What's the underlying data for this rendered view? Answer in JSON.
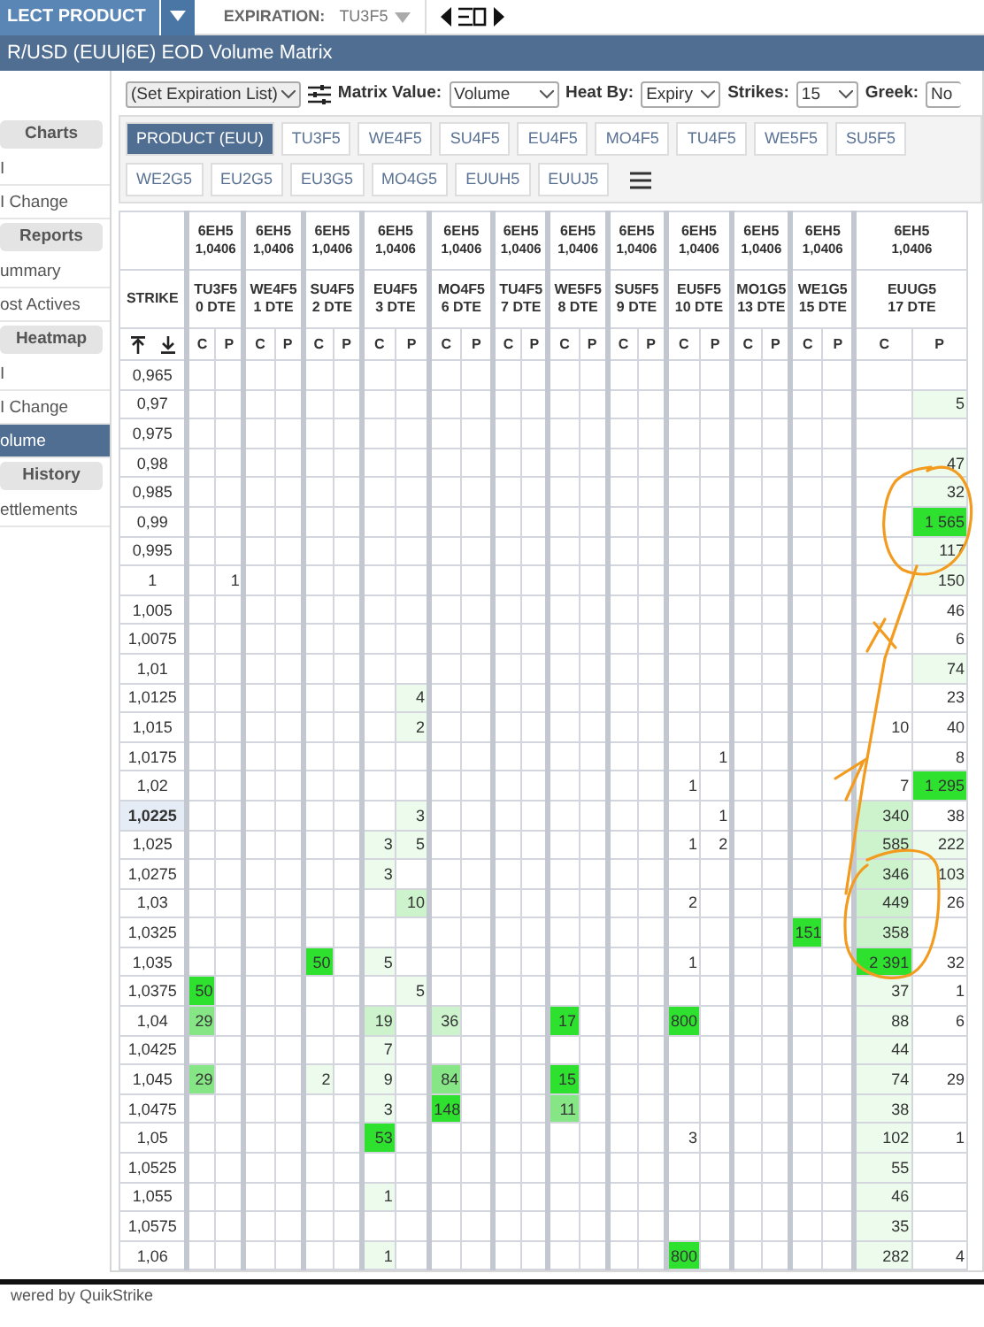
{
  "top_bar": {
    "product_button": "LECT PRODUCT",
    "expiration_label": "EXPIRATION:",
    "expiration_value": "TU3F5"
  },
  "title": "R/USD (EUU|6E) EOD Volume Matrix",
  "sidebar": [
    {
      "kind": "header",
      "label": "Charts"
    },
    {
      "kind": "item",
      "label": "I",
      "selected": false
    },
    {
      "kind": "item",
      "label": "I Change",
      "selected": false
    },
    {
      "kind": "header",
      "label": "Reports"
    },
    {
      "kind": "item",
      "label": "ummary",
      "selected": false
    },
    {
      "kind": "item",
      "label": "ost Actives",
      "selected": false
    },
    {
      "kind": "header",
      "label": "Heatmap"
    },
    {
      "kind": "item",
      "label": "I",
      "selected": false
    },
    {
      "kind": "item",
      "label": "I Change",
      "selected": false
    },
    {
      "kind": "item",
      "label": "olume",
      "selected": true
    },
    {
      "kind": "header",
      "label": "History"
    },
    {
      "kind": "item",
      "label": "ettlements",
      "selected": false
    }
  ],
  "toolbar": {
    "expiration_list": "(Set Expiration List)",
    "fields": [
      {
        "label": "Matrix Value:",
        "value": "Volume"
      },
      {
        "label": "Heat By:",
        "value": "Expiry"
      },
      {
        "label": "Strikes:",
        "value": "15"
      },
      {
        "label": "Greek:",
        "value": "No"
      }
    ]
  },
  "tab_rows": [
    [
      {
        "label": "PRODUCT (EUU)",
        "selected": true
      },
      {
        "label": "TU3F5",
        "selected": false
      },
      {
        "label": "WE4F5",
        "selected": false
      },
      {
        "label": "SU4F5",
        "selected": false
      },
      {
        "label": "EU4F5",
        "selected": false
      },
      {
        "label": "MO4F5",
        "selected": false
      },
      {
        "label": "TU4F5",
        "selected": false
      },
      {
        "label": "WE5F5",
        "selected": false
      },
      {
        "label": "SU5F5",
        "selected": false
      }
    ],
    [
      {
        "label": "WE2G5",
        "selected": false
      },
      {
        "label": "EU2G5",
        "selected": false
      },
      {
        "label": "EU3G5",
        "selected": false
      },
      {
        "label": "MO4G5",
        "selected": false
      },
      {
        "label": "EUUH5",
        "selected": false
      },
      {
        "label": "EUUJ5",
        "selected": false
      }
    ]
  ],
  "matrix": {
    "strike_label": "STRIKE",
    "expiries": [
      {
        "future": "6EH5",
        "price": "1,0406",
        "name": "TU3F5",
        "dte": "0 DTE",
        "call": "C",
        "put": "P"
      },
      {
        "future": "6EH5",
        "price": "1,0406",
        "name": "WE4F5",
        "dte": "1 DTE",
        "call": "C",
        "put": "P"
      },
      {
        "future": "6EH5",
        "price": "1,0406",
        "name": "SU4F5",
        "dte": "2 DTE",
        "call": "C",
        "put": "P"
      },
      {
        "future": "6EH5",
        "price": "1,0406",
        "name": "EU4F5",
        "dte": "3 DTE",
        "call": "C",
        "put": "P"
      },
      {
        "future": "6EH5",
        "price": "1,0406",
        "name": "MO4F5",
        "dte": "6 DTE",
        "call": "C",
        "put": "P"
      },
      {
        "future": "6EH5",
        "price": "1,0406",
        "name": "TU4F5",
        "dte": "7 DTE",
        "call": "C",
        "put": "P"
      },
      {
        "future": "6EH5",
        "price": "1,0406",
        "name": "WE5F5",
        "dte": "8 DTE",
        "call": "C",
        "put": "P"
      },
      {
        "future": "6EH5",
        "price": "1,0406",
        "name": "SU5F5",
        "dte": "9 DTE",
        "call": "C",
        "put": "P"
      },
      {
        "future": "6EH5",
        "price": "1,0406",
        "name": "EU5F5",
        "dte": "10 DTE",
        "call": "C",
        "put": "P"
      },
      {
        "future": "6EH5",
        "price": "1,0406",
        "name": "MO1G5",
        "dte": "13 DTE",
        "call": "C",
        "put": "P"
      },
      {
        "future": "6EH5",
        "price": "1,0406",
        "name": "WE1G5",
        "dte": "15 DTE",
        "call": "C",
        "put": "P"
      },
      {
        "future": "6EH5",
        "price": "1,0406",
        "name": "EUUG5",
        "dte": "17 DTE",
        "call": "C",
        "put": "P"
      }
    ],
    "rows": [
      {
        "strike": "0,965",
        "atm": false,
        "cells": [
          [
            null,
            null
          ],
          [
            null,
            null
          ],
          [
            null,
            null
          ],
          [
            null,
            null
          ],
          [
            null,
            null
          ],
          [
            null,
            null
          ],
          [
            null,
            null
          ],
          [
            null,
            null
          ],
          [
            null,
            null
          ],
          [
            null,
            null
          ],
          [
            null,
            null
          ],
          [
            null,
            null
          ]
        ]
      },
      {
        "strike": "0,97",
        "atm": false,
        "cells": [
          [
            null,
            null
          ],
          [
            null,
            null
          ],
          [
            null,
            null
          ],
          [
            null,
            null
          ],
          [
            null,
            null
          ],
          [
            null,
            null
          ],
          [
            null,
            null
          ],
          [
            null,
            null
          ],
          [
            null,
            null
          ],
          [
            null,
            null
          ],
          [
            null,
            null
          ],
          [
            null,
            {
              "value": "5",
              "color": "#ecfbec"
            }
          ]
        ]
      },
      {
        "strike": "0,975",
        "atm": false,
        "cells": [
          [
            null,
            null
          ],
          [
            null,
            null
          ],
          [
            null,
            null
          ],
          [
            null,
            null
          ],
          [
            null,
            null
          ],
          [
            null,
            null
          ],
          [
            null,
            null
          ],
          [
            null,
            null
          ],
          [
            null,
            null
          ],
          [
            null,
            null
          ],
          [
            null,
            null
          ],
          [
            null,
            null
          ]
        ]
      },
      {
        "strike": "0,98",
        "atm": false,
        "cells": [
          [
            null,
            null
          ],
          [
            null,
            null
          ],
          [
            null,
            null
          ],
          [
            null,
            null
          ],
          [
            null,
            null
          ],
          [
            null,
            null
          ],
          [
            null,
            null
          ],
          [
            null,
            null
          ],
          [
            null,
            null
          ],
          [
            null,
            null
          ],
          [
            null,
            null
          ],
          [
            null,
            {
              "value": "47",
              "color": "#ecfbec"
            }
          ]
        ]
      },
      {
        "strike": "0,985",
        "atm": false,
        "cells": [
          [
            null,
            null
          ],
          [
            null,
            null
          ],
          [
            null,
            null
          ],
          [
            null,
            null
          ],
          [
            null,
            null
          ],
          [
            null,
            null
          ],
          [
            null,
            null
          ],
          [
            null,
            null
          ],
          [
            null,
            null
          ],
          [
            null,
            null
          ],
          [
            null,
            null
          ],
          [
            null,
            {
              "value": "32",
              "color": "#ecfbec"
            }
          ]
        ]
      },
      {
        "strike": "0,99",
        "atm": false,
        "cells": [
          [
            null,
            null
          ],
          [
            null,
            null
          ],
          [
            null,
            null
          ],
          [
            null,
            null
          ],
          [
            null,
            null
          ],
          [
            null,
            null
          ],
          [
            null,
            null
          ],
          [
            null,
            null
          ],
          [
            null,
            null
          ],
          [
            null,
            null
          ],
          [
            null,
            null
          ],
          [
            null,
            {
              "value": "1 565",
              "color": "#2fe12f"
            }
          ]
        ]
      },
      {
        "strike": "0,995",
        "atm": false,
        "cells": [
          [
            null,
            null
          ],
          [
            null,
            null
          ],
          [
            null,
            null
          ],
          [
            null,
            null
          ],
          [
            null,
            null
          ],
          [
            null,
            null
          ],
          [
            null,
            null
          ],
          [
            null,
            null
          ],
          [
            null,
            null
          ],
          [
            null,
            null
          ],
          [
            null,
            null
          ],
          [
            null,
            {
              "value": "117",
              "color": "#ecfbec"
            }
          ]
        ]
      },
      {
        "strike": "1",
        "atm": false,
        "cells": [
          [
            null,
            {
              "value": "1"
            }
          ],
          [
            null,
            null
          ],
          [
            null,
            null
          ],
          [
            null,
            null
          ],
          [
            null,
            null
          ],
          [
            null,
            null
          ],
          [
            null,
            null
          ],
          [
            null,
            null
          ],
          [
            null,
            null
          ],
          [
            null,
            null
          ],
          [
            null,
            null
          ],
          [
            null,
            {
              "value": "150",
              "color": "#ecfbec"
            }
          ]
        ]
      },
      {
        "strike": "1,005",
        "atm": false,
        "cells": [
          [
            null,
            null
          ],
          [
            null,
            null
          ],
          [
            null,
            null
          ],
          [
            null,
            null
          ],
          [
            null,
            null
          ],
          [
            null,
            null
          ],
          [
            null,
            null
          ],
          [
            null,
            null
          ],
          [
            null,
            null
          ],
          [
            null,
            null
          ],
          [
            null,
            null
          ],
          [
            null,
            {
              "value": "46"
            }
          ]
        ]
      },
      {
        "strike": "1,0075",
        "atm": false,
        "cells": [
          [
            null,
            null
          ],
          [
            null,
            null
          ],
          [
            null,
            null
          ],
          [
            null,
            null
          ],
          [
            null,
            null
          ],
          [
            null,
            null
          ],
          [
            null,
            null
          ],
          [
            null,
            null
          ],
          [
            null,
            null
          ],
          [
            null,
            null
          ],
          [
            null,
            null
          ],
          [
            null,
            {
              "value": "6"
            }
          ]
        ]
      },
      {
        "strike": "1,01",
        "atm": false,
        "cells": [
          [
            null,
            null
          ],
          [
            null,
            null
          ],
          [
            null,
            null
          ],
          [
            null,
            null
          ],
          [
            null,
            null
          ],
          [
            null,
            null
          ],
          [
            null,
            null
          ],
          [
            null,
            null
          ],
          [
            null,
            null
          ],
          [
            null,
            null
          ],
          [
            null,
            null
          ],
          [
            null,
            {
              "value": "74",
              "color": "#ecfbec"
            }
          ]
        ]
      },
      {
        "strike": "1,0125",
        "atm": false,
        "cells": [
          [
            null,
            null
          ],
          [
            null,
            null
          ],
          [
            null,
            null
          ],
          [
            null,
            {
              "value": "4",
              "color": "#ecfbec"
            }
          ],
          [
            null,
            null
          ],
          [
            null,
            null
          ],
          [
            null,
            null
          ],
          [
            null,
            null
          ],
          [
            null,
            null
          ],
          [
            null,
            null
          ],
          [
            null,
            null
          ],
          [
            null,
            {
              "value": "23"
            }
          ]
        ]
      },
      {
        "strike": "1,015",
        "atm": false,
        "cells": [
          [
            null,
            null
          ],
          [
            null,
            null
          ],
          [
            null,
            null
          ],
          [
            null,
            {
              "value": "2",
              "color": "#ecfbec"
            }
          ],
          [
            null,
            null
          ],
          [
            null,
            null
          ],
          [
            null,
            null
          ],
          [
            null,
            null
          ],
          [
            null,
            null
          ],
          [
            null,
            null
          ],
          [
            null,
            null
          ],
          [
            {
              "value": "10"
            },
            {
              "value": "40"
            }
          ]
        ]
      },
      {
        "strike": "1,0175",
        "atm": false,
        "cells": [
          [
            null,
            null
          ],
          [
            null,
            null
          ],
          [
            null,
            null
          ],
          [
            null,
            null
          ],
          [
            null,
            null
          ],
          [
            null,
            null
          ],
          [
            null,
            null
          ],
          [
            null,
            null
          ],
          [
            null,
            {
              "value": "1"
            }
          ],
          [
            null,
            null
          ],
          [
            null,
            null
          ],
          [
            null,
            {
              "value": "8"
            }
          ]
        ]
      },
      {
        "strike": "1,02",
        "atm": false,
        "cells": [
          [
            null,
            null
          ],
          [
            null,
            null
          ],
          [
            null,
            null
          ],
          [
            null,
            null
          ],
          [
            null,
            null
          ],
          [
            null,
            null
          ],
          [
            null,
            null
          ],
          [
            null,
            null
          ],
          [
            {
              "value": "1"
            },
            null
          ],
          [
            null,
            null
          ],
          [
            null,
            null
          ],
          [
            {
              "value": "7"
            },
            {
              "value": "1 295",
              "color": "#2fe12f"
            }
          ]
        ]
      },
      {
        "strike": "1,0225",
        "atm": true,
        "cells": [
          [
            null,
            null
          ],
          [
            null,
            null
          ],
          [
            null,
            null
          ],
          [
            null,
            {
              "value": "3",
              "color": "#ecfbec"
            }
          ],
          [
            null,
            null
          ],
          [
            null,
            null
          ],
          [
            null,
            null
          ],
          [
            null,
            null
          ],
          [
            null,
            {
              "value": "1"
            }
          ],
          [
            null,
            null
          ],
          [
            null,
            null
          ],
          [
            {
              "value": "340",
              "color": "#cdf3cd"
            },
            {
              "value": "38"
            }
          ]
        ]
      },
      {
        "strike": "1,025",
        "atm": false,
        "cells": [
          [
            null,
            null
          ],
          [
            null,
            null
          ],
          [
            null,
            null
          ],
          [
            {
              "value": "3",
              "color": "#ecfbec"
            },
            {
              "value": "5",
              "color": "#ecfbec"
            }
          ],
          [
            null,
            null
          ],
          [
            null,
            null
          ],
          [
            null,
            null
          ],
          [
            null,
            null
          ],
          [
            {
              "value": "1"
            },
            {
              "value": "2"
            }
          ],
          [
            null,
            null
          ],
          [
            null,
            null
          ],
          [
            {
              "value": "585",
              "color": "#cdf3cd"
            },
            {
              "value": "222",
              "color": "#ecfbec"
            }
          ]
        ]
      },
      {
        "strike": "1,0275",
        "atm": false,
        "cells": [
          [
            null,
            null
          ],
          [
            null,
            null
          ],
          [
            null,
            null
          ],
          [
            {
              "value": "3",
              "color": "#ecfbec"
            },
            null
          ],
          [
            null,
            null
          ],
          [
            null,
            null
          ],
          [
            null,
            null
          ],
          [
            null,
            null
          ],
          [
            null,
            null
          ],
          [
            null,
            null
          ],
          [
            null,
            null
          ],
          [
            {
              "value": "346",
              "color": "#cdf3cd"
            },
            {
              "value": "103",
              "color": "#ecfbec"
            }
          ]
        ]
      },
      {
        "strike": "1,03",
        "atm": false,
        "cells": [
          [
            null,
            null
          ],
          [
            null,
            null
          ],
          [
            null,
            null
          ],
          [
            null,
            {
              "value": "10",
              "color": "#cdf3cd"
            }
          ],
          [
            null,
            null
          ],
          [
            null,
            null
          ],
          [
            null,
            null
          ],
          [
            null,
            null
          ],
          [
            {
              "value": "2"
            },
            null
          ],
          [
            null,
            null
          ],
          [
            null,
            null
          ],
          [
            {
              "value": "449",
              "color": "#cdf3cd"
            },
            {
              "value": "26"
            }
          ]
        ]
      },
      {
        "strike": "1,0325",
        "atm": false,
        "cells": [
          [
            null,
            null
          ],
          [
            null,
            null
          ],
          [
            null,
            null
          ],
          [
            null,
            null
          ],
          [
            null,
            null
          ],
          [
            null,
            null
          ],
          [
            null,
            null
          ],
          [
            null,
            null
          ],
          [
            null,
            null
          ],
          [
            null,
            null
          ],
          [
            {
              "value": "151",
              "color": "#2fe12f"
            },
            null
          ],
          [
            {
              "value": "358",
              "color": "#cdf3cd"
            },
            null
          ]
        ]
      },
      {
        "strike": "1,035",
        "atm": false,
        "cells": [
          [
            null,
            null
          ],
          [
            null,
            null
          ],
          [
            {
              "value": "50",
              "color": "#2fe12f"
            },
            null
          ],
          [
            {
              "value": "5",
              "color": "#ecfbec"
            },
            null
          ],
          [
            null,
            null
          ],
          [
            null,
            null
          ],
          [
            null,
            null
          ],
          [
            null,
            null
          ],
          [
            {
              "value": "1"
            },
            null
          ],
          [
            null,
            null
          ],
          [
            null,
            null
          ],
          [
            {
              "value": "2 391",
              "color": "#2fe12f"
            },
            {
              "value": "32"
            }
          ]
        ]
      },
      {
        "strike": "1,0375",
        "atm": false,
        "cells": [
          [
            {
              "value": "50",
              "color": "#2fe12f"
            },
            null
          ],
          [
            null,
            null
          ],
          [
            null,
            null
          ],
          [
            null,
            {
              "value": "5",
              "color": "#ecfbec"
            }
          ],
          [
            null,
            null
          ],
          [
            null,
            null
          ],
          [
            null,
            null
          ],
          [
            null,
            null
          ],
          [
            null,
            null
          ],
          [
            null,
            null
          ],
          [
            null,
            null
          ],
          [
            {
              "value": "37",
              "color": "#ecfbec"
            },
            {
              "value": "1"
            }
          ]
        ]
      },
      {
        "strike": "1,04",
        "atm": false,
        "cells": [
          [
            {
              "value": "29",
              "color": "#86e686"
            },
            null
          ],
          [
            null,
            null
          ],
          [
            null,
            null
          ],
          [
            {
              "value": "19",
              "color": "#cdf3cd"
            },
            null
          ],
          [
            {
              "value": "36",
              "color": "#cdf3cd"
            },
            null
          ],
          [
            null,
            null
          ],
          [
            {
              "value": "17",
              "color": "#2fe12f"
            },
            null
          ],
          [
            null,
            null
          ],
          [
            {
              "value": "800",
              "color": "#2fe12f"
            },
            null
          ],
          [
            null,
            null
          ],
          [
            null,
            null
          ],
          [
            {
              "value": "88",
              "color": "#ecfbec"
            },
            {
              "value": "6"
            }
          ]
        ]
      },
      {
        "strike": "1,0425",
        "atm": false,
        "cells": [
          [
            null,
            null
          ],
          [
            null,
            null
          ],
          [
            null,
            null
          ],
          [
            {
              "value": "7",
              "color": "#ecfbec"
            },
            null
          ],
          [
            null,
            null
          ],
          [
            null,
            null
          ],
          [
            null,
            null
          ],
          [
            null,
            null
          ],
          [
            null,
            null
          ],
          [
            null,
            null
          ],
          [
            null,
            null
          ],
          [
            {
              "value": "44",
              "color": "#ecfbec"
            },
            null
          ]
        ]
      },
      {
        "strike": "1,045",
        "atm": false,
        "cells": [
          [
            {
              "value": "29",
              "color": "#86e686"
            },
            null
          ],
          [
            null,
            null
          ],
          [
            {
              "value": "2",
              "color": "#ecfbec"
            },
            null
          ],
          [
            {
              "value": "9",
              "color": "#ecfbec"
            },
            null
          ],
          [
            {
              "value": "84",
              "color": "#86e686"
            },
            null
          ],
          [
            null,
            null
          ],
          [
            {
              "value": "15",
              "color": "#2fe12f"
            },
            null
          ],
          [
            null,
            null
          ],
          [
            null,
            null
          ],
          [
            null,
            null
          ],
          [
            null,
            null
          ],
          [
            {
              "value": "74",
              "color": "#ecfbec"
            },
            {
              "value": "29"
            }
          ]
        ]
      },
      {
        "strike": "1,0475",
        "atm": false,
        "cells": [
          [
            null,
            null
          ],
          [
            null,
            null
          ],
          [
            null,
            null
          ],
          [
            {
              "value": "3",
              "color": "#ecfbec"
            },
            null
          ],
          [
            {
              "value": "148",
              "color": "#2fe12f"
            },
            null
          ],
          [
            null,
            null
          ],
          [
            {
              "value": "11",
              "color": "#86e686"
            },
            null
          ],
          [
            null,
            null
          ],
          [
            null,
            null
          ],
          [
            null,
            null
          ],
          [
            null,
            null
          ],
          [
            {
              "value": "38",
              "color": "#ecfbec"
            },
            null
          ]
        ]
      },
      {
        "strike": "1,05",
        "atm": false,
        "cells": [
          [
            null,
            null
          ],
          [
            null,
            null
          ],
          [
            null,
            null
          ],
          [
            {
              "value": "53",
              "color": "#2fe12f"
            },
            null
          ],
          [
            null,
            null
          ],
          [
            null,
            null
          ],
          [
            null,
            null
          ],
          [
            null,
            null
          ],
          [
            {
              "value": "3"
            },
            null
          ],
          [
            null,
            null
          ],
          [
            null,
            null
          ],
          [
            {
              "value": "102",
              "color": "#ecfbec"
            },
            {
              "value": "1"
            }
          ]
        ]
      },
      {
        "strike": "1,0525",
        "atm": false,
        "cells": [
          [
            null,
            null
          ],
          [
            null,
            null
          ],
          [
            null,
            null
          ],
          [
            null,
            null
          ],
          [
            null,
            null
          ],
          [
            null,
            null
          ],
          [
            null,
            null
          ],
          [
            null,
            null
          ],
          [
            null,
            null
          ],
          [
            null,
            null
          ],
          [
            null,
            null
          ],
          [
            {
              "value": "55",
              "color": "#ecfbec"
            },
            null
          ]
        ]
      },
      {
        "strike": "1,055",
        "atm": false,
        "cells": [
          [
            null,
            null
          ],
          [
            null,
            null
          ],
          [
            null,
            null
          ],
          [
            {
              "value": "1",
              "color": "#ecfbec"
            },
            null
          ],
          [
            null,
            null
          ],
          [
            null,
            null
          ],
          [
            null,
            null
          ],
          [
            null,
            null
          ],
          [
            null,
            null
          ],
          [
            null,
            null
          ],
          [
            null,
            null
          ],
          [
            {
              "value": "46",
              "color": "#ecfbec"
            },
            null
          ]
        ]
      },
      {
        "strike": "1,0575",
        "atm": false,
        "cells": [
          [
            null,
            null
          ],
          [
            null,
            null
          ],
          [
            null,
            null
          ],
          [
            null,
            null
          ],
          [
            null,
            null
          ],
          [
            null,
            null
          ],
          [
            null,
            null
          ],
          [
            null,
            null
          ],
          [
            null,
            null
          ],
          [
            null,
            null
          ],
          [
            null,
            null
          ],
          [
            {
              "value": "35",
              "color": "#ecfbec"
            },
            null
          ]
        ]
      },
      {
        "strike": "1,06",
        "atm": false,
        "cells": [
          [
            null,
            null
          ],
          [
            null,
            null
          ],
          [
            null,
            null
          ],
          [
            {
              "value": "1",
              "color": "#ecfbec"
            },
            null
          ],
          [
            null,
            null
          ],
          [
            null,
            null
          ],
          [
            null,
            null
          ],
          [
            null,
            null
          ],
          [
            {
              "value": "800",
              "color": "#2fe12f"
            },
            null
          ],
          [
            null,
            null
          ],
          [
            null,
            null
          ],
          [
            {
              "value": "282",
              "color": "#ecfbec"
            },
            {
              "value": "4"
            }
          ]
        ]
      }
    ]
  },
  "footer": "wered by QuikStrike"
}
